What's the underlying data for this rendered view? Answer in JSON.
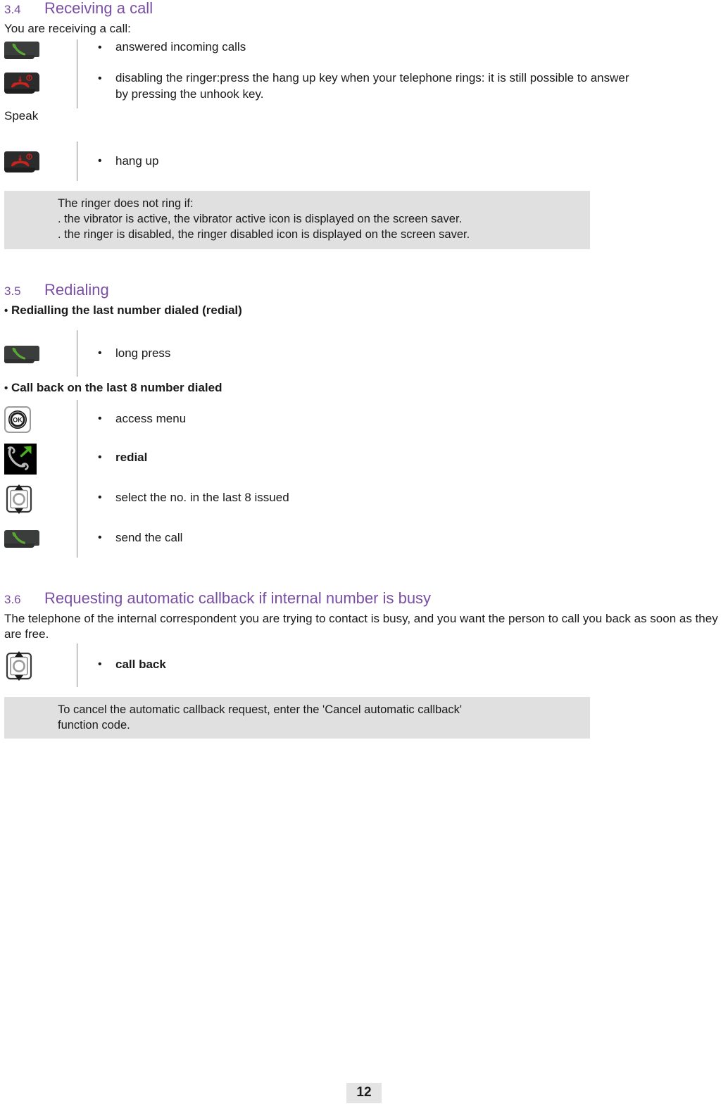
{
  "document": {
    "page_number": "12"
  },
  "sections": [
    {
      "number": "3.4",
      "title": "Receiving a call",
      "intro": "You are receiving a call:",
      "plain_label": "Speak",
      "groups": [
        {
          "rows": [
            {
              "icon": "offhook-key-icon",
              "bullet": "•",
              "text": "answered incoming calls",
              "bold": false
            },
            {
              "icon": "hangup-key-icon",
              "bullet": "•",
              "text": "disabling the ringer:press the hang up key when your telephone rings: it is still possible to answer by pressing the unhook key.",
              "bold": false
            }
          ]
        },
        {
          "rows": [
            {
              "icon": "hangup-key-icon",
              "bullet": "•",
              "text": "hang up",
              "bold": false
            }
          ]
        }
      ],
      "note": [
        "The ringer does not ring if:",
        ". the vibrator is active, the vibrator active icon is displayed on the screen saver.",
        ". the ringer is disabled, the ringer disabled icon is displayed on the screen saver."
      ]
    },
    {
      "number": "3.5",
      "title": "Redialing",
      "subheads": [
        {
          "bullet": "•",
          "text": "Redialling the last number dialed (redial)"
        },
        {
          "bullet": "•",
          "text": "Call back on the last 8 number dialed"
        }
      ],
      "groups": [
        {
          "rows": [
            {
              "icon": "offhook-key-icon",
              "bullet": "•",
              "text": "long press",
              "bold": false
            }
          ]
        },
        {
          "rows": [
            {
              "icon": "ok-key-icon",
              "bullet": "•",
              "text": "access menu",
              "bold": false
            },
            {
              "icon": "outgoing-call-icon",
              "bullet": "•",
              "text": "redial",
              "bold": true
            },
            {
              "icon": "navigator-up-down-icon",
              "bullet": "•",
              "text": "select the no. in the last 8 issued",
              "bold": false
            },
            {
              "icon": "offhook-key-icon",
              "bullet": "•",
              "text": "send the call",
              "bold": false
            }
          ]
        }
      ]
    },
    {
      "number": "3.6",
      "title": "Requesting automatic callback if internal number is busy",
      "intro": "The telephone of the internal correspondent you are trying to contact is busy, and you want the person to call you back as soon as they are free.",
      "groups": [
        {
          "rows": [
            {
              "icon": "navigator-up-down-icon",
              "bullet": "•",
              "text": "call back",
              "bold": true
            }
          ]
        }
      ],
      "note": [
        "To cancel the automatic callback request, enter the 'Cancel automatic callback'",
        "function code."
      ]
    }
  ],
  "colors": {
    "heading": "#7a4fa3",
    "note_background": "#e0e0e0",
    "body_text": "#1a1a1a",
    "handset_green": "#5aa832",
    "handset_red": "#c9231f"
  }
}
